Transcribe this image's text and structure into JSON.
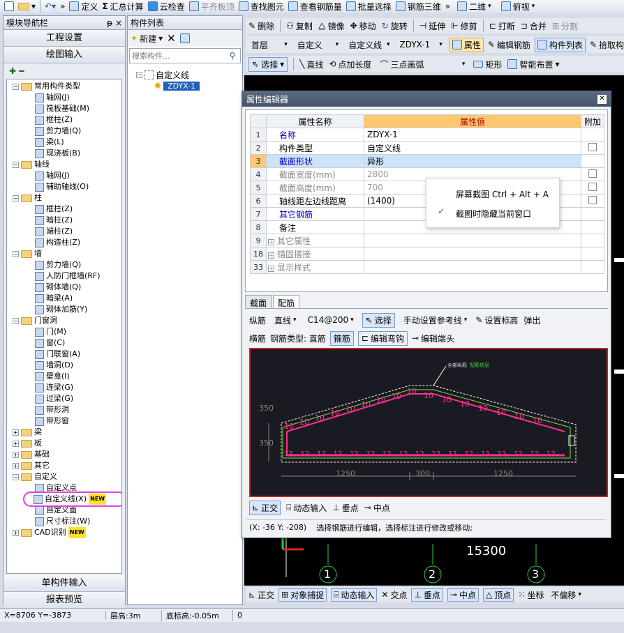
{
  "top_toolbar": {
    "items": [
      "定义",
      "汇总计算",
      "云检查",
      "平齐板顶",
      "查找图元",
      "查看钢筋量",
      "批量选择",
      "钢筋三维",
      "二维",
      "俯视"
    ]
  },
  "nav_panel": {
    "title": "模块导航栏",
    "pin_label": "ᵽ",
    "close_label": "×",
    "btn_project": "工程设置",
    "btn_draw": "绘图输入",
    "btn_single": "单构件输入",
    "btn_report": "报表预览",
    "tree": [
      {
        "level": 1,
        "type": "folder",
        "exp": "−",
        "label": "常用构件类型"
      },
      {
        "level": 2,
        "type": "item",
        "label": "轴网(J)"
      },
      {
        "level": 2,
        "type": "item",
        "label": "筏板基础(M)"
      },
      {
        "level": 2,
        "type": "item",
        "label": "框柱(Z)"
      },
      {
        "level": 2,
        "type": "item",
        "label": "剪力墙(Q)"
      },
      {
        "level": 2,
        "type": "item",
        "label": "梁(L)"
      },
      {
        "level": 2,
        "type": "item",
        "label": "现浇板(B)"
      },
      {
        "level": 1,
        "type": "folder",
        "exp": "−",
        "label": "轴线"
      },
      {
        "level": 2,
        "type": "item",
        "label": "轴网(J)"
      },
      {
        "level": 2,
        "type": "item",
        "label": "辅助轴线(O)"
      },
      {
        "level": 1,
        "type": "folder",
        "exp": "−",
        "label": "柱"
      },
      {
        "level": 2,
        "type": "item",
        "label": "框柱(Z)"
      },
      {
        "level": 2,
        "type": "item",
        "label": "暗柱(Z)"
      },
      {
        "level": 2,
        "type": "item",
        "label": "端柱(Z)"
      },
      {
        "level": 2,
        "type": "item",
        "label": "构造柱(Z)"
      },
      {
        "level": 1,
        "type": "folder",
        "exp": "−",
        "label": "墙"
      },
      {
        "level": 2,
        "type": "item",
        "label": "剪力墙(Q)"
      },
      {
        "level": 2,
        "type": "item",
        "label": "人防门框墙(RF)"
      },
      {
        "level": 2,
        "type": "item",
        "label": "砌体墙(Q)"
      },
      {
        "level": 2,
        "type": "item",
        "label": "暗梁(A)"
      },
      {
        "level": 2,
        "type": "item",
        "label": "砌体加筋(Y)"
      },
      {
        "level": 1,
        "type": "folder",
        "exp": "−",
        "label": "门窗洞"
      },
      {
        "level": 2,
        "type": "item",
        "label": "门(M)"
      },
      {
        "level": 2,
        "type": "item",
        "label": "窗(C)"
      },
      {
        "level": 2,
        "type": "item",
        "label": "门联窗(A)"
      },
      {
        "level": 2,
        "type": "item",
        "label": "墙洞(D)"
      },
      {
        "level": 2,
        "type": "item",
        "label": "壁龛(I)"
      },
      {
        "level": 2,
        "type": "item",
        "label": "连梁(G)"
      },
      {
        "level": 2,
        "type": "item",
        "label": "过梁(G)"
      },
      {
        "level": 2,
        "type": "item",
        "label": "带形洞"
      },
      {
        "level": 2,
        "type": "item",
        "label": "带形窗"
      },
      {
        "level": 1,
        "type": "folder",
        "exp": "+",
        "label": "梁"
      },
      {
        "level": 1,
        "type": "folder",
        "exp": "+",
        "label": "板"
      },
      {
        "level": 1,
        "type": "folder",
        "exp": "+",
        "label": "基础"
      },
      {
        "level": 1,
        "type": "folder",
        "exp": "+",
        "label": "其它"
      },
      {
        "level": 1,
        "type": "folder",
        "exp": "−",
        "label": "自定义"
      },
      {
        "level": 2,
        "type": "item",
        "label": "自定义点"
      },
      {
        "level": 2,
        "type": "item",
        "label": "自定义线(X)",
        "highlight": true,
        "badge": "NEW"
      },
      {
        "level": 2,
        "type": "item",
        "label": "自定义面"
      },
      {
        "level": 2,
        "type": "item",
        "label": "尺寸标注(W)"
      },
      {
        "level": 1,
        "type": "folder",
        "exp": "+",
        "label": "CAD识别",
        "badge": "NEW"
      }
    ]
  },
  "component_panel": {
    "title": "构件列表",
    "new_label": "新建",
    "search_placeholder": "搜索构件...",
    "tree_root": "自定义线",
    "tree_child": "ZDYX-1"
  },
  "edit_toolbar": {
    "items": [
      "删除",
      "复制",
      "镜像",
      "移动",
      "旋转",
      "延伸",
      "修剪",
      "打断",
      "合并",
      "分割"
    ]
  },
  "floor_bar": {
    "floor": "首层",
    "category": "自定义",
    "type": "自定义线",
    "name": "ZDYX-1",
    "btn_props": "属性",
    "btn_edit_rebar": "编辑钢筋",
    "btn_list": "构件列表",
    "btn_pick": "拾取构"
  },
  "draw_bar": {
    "select": "选择",
    "line": "直线",
    "point_len": "点加长度",
    "arc": "三点画弧",
    "rect": "矩形",
    "smart": "智能布置"
  },
  "property_editor": {
    "title": "属性编辑器",
    "col_name": "属性名称",
    "col_value": "属性值",
    "col_attach": "附加",
    "rows": [
      {
        "num": "1",
        "name": "名称",
        "value": "ZDYX-1",
        "name_color": "#0000cc",
        "checkbox": false
      },
      {
        "num": "2",
        "name": "构件类型",
        "value": "自定义线",
        "name_color": "#000000",
        "checkbox": true
      },
      {
        "num": "3",
        "name": "截面形状",
        "value": "异形",
        "name_color": "#0000cc",
        "checkbox": false,
        "selected": true
      },
      {
        "num": "4",
        "name": "截面宽度(mm)",
        "value": "2800",
        "name_color": "#888888",
        "value_gray": true,
        "checkbox": true
      },
      {
        "num": "5",
        "name": "截面高度(mm)",
        "value": "700",
        "name_color": "#888888",
        "value_gray": true,
        "checkbox": true
      },
      {
        "num": "6",
        "name": "轴线距左边线距离",
        "value": "(1400)",
        "name_color": "#000000",
        "checkbox": true
      },
      {
        "num": "7",
        "name": "其它钢筋",
        "value": "",
        "name_color": "#0000cc",
        "checkbox": false
      },
      {
        "num": "8",
        "name": "备注",
        "value": "",
        "name_color": "#000000",
        "checkbox": false
      },
      {
        "num": "9",
        "name": "其它属性",
        "value": "",
        "name_color": "#888888",
        "expand": true,
        "checkbox": false
      },
      {
        "num": "18",
        "name": "锚固搭接",
        "value": "",
        "name_color": "#888888",
        "expand": true,
        "checkbox": false
      },
      {
        "num": "33",
        "name": "显示样式",
        "value": "",
        "name_color": "#888888",
        "expand": true,
        "checkbox": false
      }
    ],
    "tab_section": "截面",
    "tab_rebar": "配筋",
    "rebar_bar1": {
      "vertical": "纵筋",
      "line": "直线",
      "spec": "C14@200",
      "select": "选择",
      "manual_ref": "手动设置参考线",
      "set_mark": "设置标高",
      "popup": "弹出"
    },
    "rebar_bar2": {
      "horizontal": "横筋",
      "type_label": "钢筋类型: 直筋",
      "stirrup": "箍筋",
      "edit_hook": "编辑弯钩",
      "edit_end": "编辑端头"
    },
    "cad": {
      "dim_left_top": "350",
      "dim_left_bot": "350",
      "dim_bottom": [
        "1250",
        "300",
        "1250"
      ],
      "rebar_labels": [
        "10",
        "10",
        "10",
        "10",
        "10",
        "10",
        "10",
        "10",
        "10",
        "10",
        "10",
        "10",
        "10",
        "10",
        "10",
        "10"
      ],
      "bottom_labels": [
        "12",
        "12",
        "12",
        "12",
        "12",
        "12",
        "12",
        "12",
        "12",
        "12",
        "12",
        "12",
        "12",
        "12",
        "12",
        "12",
        "12"
      ],
      "note1": "全部纵筋",
      "note2": "配筋信息"
    },
    "bottom_bar": {
      "ortho": "正交",
      "dyn": "动态输入",
      "perp": "垂点",
      "mid": "中点"
    },
    "status": {
      "coords": "(X: -36 Y: -208)",
      "hint": "选择钢筋进行编辑，选择标注进行修改或移动;"
    }
  },
  "context_menu": {
    "item1": "屏幕截图 Ctrl + Alt + A",
    "item2": "截图时隐藏当前窗口"
  },
  "drawing_area": {
    "dim": "15300",
    "axis": [
      "1",
      "2",
      "3"
    ]
  },
  "snap_bar": {
    "items": [
      "正交",
      "对象捕捉",
      "动态输入",
      "交点",
      "垂点",
      "中点",
      "顶点",
      "坐标",
      "不偏移"
    ]
  },
  "status_bar": {
    "coords": "X=8706 Y=-3873",
    "floor_height": "层高:3m",
    "bottom_height": "底标高:-0.05m",
    "val": "0"
  }
}
